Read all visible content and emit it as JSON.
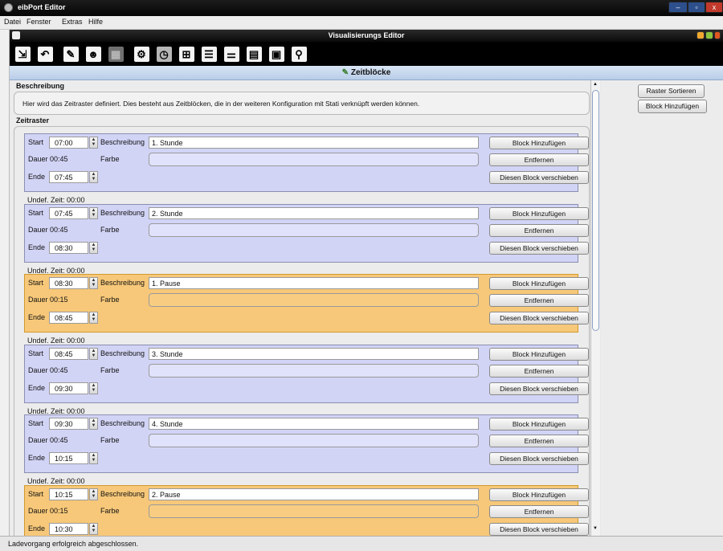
{
  "window": {
    "title": "eibPort Editor"
  },
  "menu": [
    "Datei",
    "Fenster",
    "Extras",
    "Hilfe"
  ],
  "editor": {
    "title": "Visualisierungs Editor"
  },
  "toolbar_icons": [
    "save-exit-icon",
    "undo-icon",
    "pencil-icon",
    "users-icon",
    "grid-icon",
    "gear-icon",
    "timer-icon",
    "tree-icon",
    "list-icon",
    "sliders-icon",
    "document-icon",
    "calendar-icon",
    "magnifier-icon"
  ],
  "panel": {
    "title": "Zeitblöcke"
  },
  "beschreibung": {
    "title": "Beschreibung",
    "text": "Hier wird das Zeitraster definiert. Dies besteht aus Zeitblöcken, die in der weiteren Konfiguration mit Stati verknüpft werden können."
  },
  "zeitraster": {
    "title": "Zeitraster"
  },
  "labels": {
    "start": "Start",
    "beschreibung": "Beschreibung",
    "farbe": "Farbe",
    "ende": "Ende",
    "add": "Block Hinzufügen",
    "remove": "Entfernen",
    "move": "Diesen Block verschieben"
  },
  "blocks": [
    {
      "start": "07:00",
      "desc": "1. Stunde",
      "dauer": "Dauer 00:45",
      "ende": "07:45",
      "type": "lesson",
      "undef": "Undef. Zeit: 00:00"
    },
    {
      "start": "07:45",
      "desc": "2. Stunde",
      "dauer": "Dauer 00:45",
      "ende": "08:30",
      "type": "lesson",
      "undef": "Undef. Zeit: 00:00"
    },
    {
      "start": "08:30",
      "desc": "1. Pause",
      "dauer": "Dauer 00:15",
      "ende": "08:45",
      "type": "pause",
      "undef": "Undef. Zeit: 00:00"
    },
    {
      "start": "08:45",
      "desc": "3. Stunde",
      "dauer": "Dauer 00:45",
      "ende": "09:30",
      "type": "lesson",
      "undef": "Undef. Zeit: 00:00"
    },
    {
      "start": "09:30",
      "desc": "4. Stunde",
      "dauer": "Dauer 00:45",
      "ende": "10:15",
      "type": "lesson",
      "undef": "Undef. Zeit: 00:00"
    },
    {
      "start": "10:15",
      "desc": "2. Pause",
      "dauer": "Dauer 00:15",
      "ende": "10:30",
      "type": "pause"
    }
  ],
  "side_buttons": {
    "sort": "Raster Sortieren",
    "add": "Block Hinzufügen"
  },
  "status": "Ladevorgang erfolgreich abgeschlossen.",
  "colors": {
    "lesson_bg": "#d2d4f6",
    "pause_bg": "#f7c879",
    "header_bg": "#c8d8ef"
  }
}
